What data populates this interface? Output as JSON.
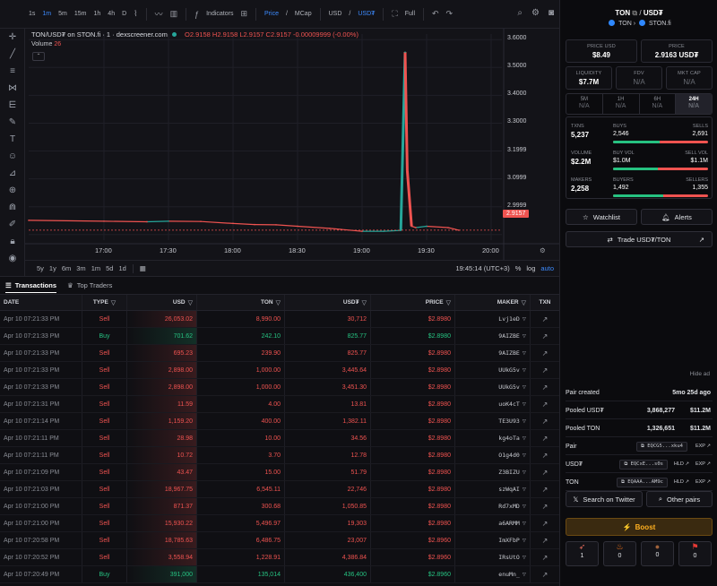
{
  "toolbar": {
    "intervals": [
      "1s",
      "1m",
      "5m",
      "15m",
      "1h",
      "4h",
      "D"
    ],
    "active_interval": "1m",
    "indicators_label": "Indicators",
    "price_label": "Price",
    "mcap_label": "MCap",
    "currency_usd": "USD",
    "currency_usdt": "USD₮",
    "full_label": "Full"
  },
  "chart": {
    "legend_title": "TON/USD₮ on STON.fi · 1 · dexscreener.com",
    "ohlc": "O2.9158 H2.9158 L2.9157 C2.9157 -0.00009999 (-0.00%)",
    "volume_label": "Volume",
    "volume_value": "26",
    "price_tag": "2.9157",
    "range_buttons": [
      "5y",
      "1y",
      "6m",
      "3m",
      "1m",
      "5d",
      "1d"
    ],
    "time_readout": "19:45:14 (UTC+3)",
    "pct_label": "%",
    "log_label": "log",
    "auto_label": "auto"
  },
  "chart_data": {
    "type": "line",
    "title": "",
    "xlabel": "",
    "ylabel": "",
    "x_ticks": [
      "17:00",
      "17:30",
      "18:00",
      "18:30",
      "19:00",
      "19:30",
      "20:00"
    ],
    "y_ticks": [
      3.6,
      3.5,
      3.4,
      3.3,
      3.2,
      3.1,
      3.0,
      2.9
    ],
    "y_tick_labels": [
      "3.6000",
      "3.5000",
      "3.4000",
      "3.3000",
      "3.1999",
      "3.0999",
      "2.9999",
      "2.9157"
    ],
    "ylim": [
      2.88,
      3.62
    ],
    "series": [
      {
        "x": [
          "16:25",
          "17:00",
          "17:20",
          "17:30",
          "17:45",
          "18:00",
          "18:10",
          "18:20",
          "18:30",
          "18:45",
          "19:00",
          "19:10",
          "19:18",
          "19:20",
          "19:21",
          "19:23",
          "19:25",
          "19:30",
          "19:40",
          "19:45"
        ],
        "values": [
          2.951,
          2.948,
          2.946,
          2.948,
          2.947,
          2.94,
          2.936,
          2.935,
          2.93,
          2.922,
          2.912,
          2.912,
          2.915,
          3.555,
          3.13,
          2.93,
          2.925,
          2.93,
          2.925,
          2.9157
        ]
      }
    ],
    "grid": true
  },
  "transactions": {
    "tab_transactions": "Transactions",
    "tab_top_traders": "Top Traders",
    "headers": [
      "DATE",
      "TYPE",
      "USD",
      "TON",
      "USD₮",
      "PRICE",
      "MAKER",
      "TXN"
    ],
    "rows": [
      {
        "date": "Apr 10 07:21:33 PM",
        "type": "Sell",
        "usd": "26,053.02",
        "ton": "8,990.00",
        "usdt": "30,712",
        "price": "$2.8980",
        "maker": "Lvj1eD"
      },
      {
        "date": "Apr 10 07:21:33 PM",
        "type": "Buy",
        "usd": "701.62",
        "ton": "242.10",
        "usdt": "825.77",
        "price": "$2.8980",
        "maker": "9AIZBE"
      },
      {
        "date": "Apr 10 07:21:33 PM",
        "type": "Sell",
        "usd": "695.23",
        "ton": "239.90",
        "usdt": "825.77",
        "price": "$2.8980",
        "maker": "9AIZBE"
      },
      {
        "date": "Apr 10 07:21:33 PM",
        "type": "Sell",
        "usd": "2,898.00",
        "ton": "1,000.00",
        "usdt": "3,445.64",
        "price": "$2.8980",
        "maker": "UUkG5v"
      },
      {
        "date": "Apr 10 07:21:33 PM",
        "type": "Sell",
        "usd": "2,898.00",
        "ton": "1,000.00",
        "usdt": "3,451.30",
        "price": "$2.8980",
        "maker": "UUkG5v"
      },
      {
        "date": "Apr 10 07:21:31 PM",
        "type": "Sell",
        "usd": "11.59",
        "ton": "4.00",
        "usdt": "13.81",
        "price": "$2.8980",
        "maker": "uoK4cT"
      },
      {
        "date": "Apr 10 07:21:14 PM",
        "type": "Sell",
        "usd": "1,159.20",
        "ton": "400.00",
        "usdt": "1,382.11",
        "price": "$2.8980",
        "maker": "TE3U93"
      },
      {
        "date": "Apr 10 07:21:11 PM",
        "type": "Sell",
        "usd": "28.98",
        "ton": "10.00",
        "usdt": "34.56",
        "price": "$2.8980",
        "maker": "kg4oTa"
      },
      {
        "date": "Apr 10 07:21:11 PM",
        "type": "Sell",
        "usd": "10.72",
        "ton": "3.70",
        "usdt": "12.78",
        "price": "$2.8980",
        "maker": "O1g4d0"
      },
      {
        "date": "Apr 10 07:21:09 PM",
        "type": "Sell",
        "usd": "43.47",
        "ton": "15.00",
        "usdt": "51.79",
        "price": "$2.8980",
        "maker": "Z3BIZU"
      },
      {
        "date": "Apr 10 07:21:03 PM",
        "type": "Sell",
        "usd": "18,967.75",
        "ton": "6,545.11",
        "usdt": "22,746",
        "price": "$2.8980",
        "maker": "szWqAI"
      },
      {
        "date": "Apr 10 07:21:00 PM",
        "type": "Sell",
        "usd": "871.37",
        "ton": "300.68",
        "usdt": "1,050.85",
        "price": "$2.8980",
        "maker": "Rd7xMD"
      },
      {
        "date": "Apr 10 07:21:00 PM",
        "type": "Sell",
        "usd": "15,930.22",
        "ton": "5,496.97",
        "usdt": "19,303",
        "price": "$2.8980",
        "maker": "a6ARMM"
      },
      {
        "date": "Apr 10 07:20:58 PM",
        "type": "Sell",
        "usd": "18,785.63",
        "ton": "6,486.75",
        "usdt": "23,007",
        "price": "$2.8960",
        "maker": "ImXFbP"
      },
      {
        "date": "Apr 10 07:20:52 PM",
        "type": "Sell",
        "usd": "3,558.94",
        "ton": "1,228.91",
        "usdt": "4,386.84",
        "price": "$2.8960",
        "maker": "IRsUtO"
      },
      {
        "date": "Apr 10 07:20:49 PM",
        "type": "Buy",
        "usd": "391,000",
        "ton": "135,014",
        "usdt": "436,400",
        "price": "$2.8960",
        "maker": "enuMn_"
      }
    ]
  },
  "right": {
    "pair_base": "TON",
    "pair_quote": "USD₮",
    "chain": "TON",
    "dex": "STON.fi",
    "price_usd_label": "PRICE USD",
    "price_usd": "$8.49",
    "price_label": "PRICE",
    "price_value": "2.9163 USD₮",
    "liquidity_label": "LIQUIDITY",
    "liquidity": "$7.7M",
    "fdv_label": "FDV",
    "fdv": "N/A",
    "mktcap_label": "MKT CAP",
    "mktcap": "N/A",
    "timeframes": [
      {
        "label": "5M",
        "value": "N/A"
      },
      {
        "label": "1H",
        "value": "N/A"
      },
      {
        "label": "6H",
        "value": "N/A"
      },
      {
        "label": "24H",
        "value": "N/A"
      }
    ],
    "txns_label": "TXNS",
    "txns": "5,237",
    "buys_label": "BUYS",
    "buys": "2,546",
    "sells_label": "SELLS",
    "sells": "2,691",
    "volume_label": "VOLUME",
    "volume": "$2.2M",
    "buy_vol_label": "BUY VOL",
    "buy_vol": "$1.0M",
    "sell_vol_label": "SELL VOL",
    "sell_vol": "$1.1M",
    "makers_label": "MAKERS",
    "makers": "2,258",
    "buyers_label": "BUYERS",
    "buyers": "1,492",
    "sellers_label": "SELLERS",
    "sellers": "1,355",
    "buys_share": 0.486,
    "buy_vol_share": 0.476,
    "buyers_share": 0.524,
    "watchlist_label": "Watchlist",
    "alerts_label": "Alerts",
    "trade_label": "Trade USD₮/TON",
    "hide_ad_label": "Hide ad",
    "pair_created_label": "Pair created",
    "pair_created": "5mo 25d ago",
    "pooled_usdt_label": "Pooled USD₮",
    "pooled_usdt": "3,868,277",
    "pooled_usdt_usd": "$11.2M",
    "pooled_ton_label": "Pooled TON",
    "pooled_ton": "1,326,651",
    "pooled_ton_usd": "$11.2M",
    "pair_label": "Pair",
    "pair_addr": "EQCG5...xku4",
    "usdt_label": "USD₮",
    "usdt_addr": "EQCxE...s0s",
    "ton_label": "TON",
    "ton_addr": "EQAAA...AM9c",
    "hld_label": "HLD",
    "exp_label": "EXP",
    "search_twitter_label": "Search on Twitter",
    "other_pairs_label": "Other pairs",
    "boost_label": "Boost",
    "reactions": [
      {
        "icon": "rocket-icon",
        "count": "1"
      },
      {
        "icon": "fire-icon",
        "count": "0"
      },
      {
        "icon": "poop-icon",
        "count": "0"
      },
      {
        "icon": "flag-icon",
        "count": "0"
      }
    ]
  }
}
